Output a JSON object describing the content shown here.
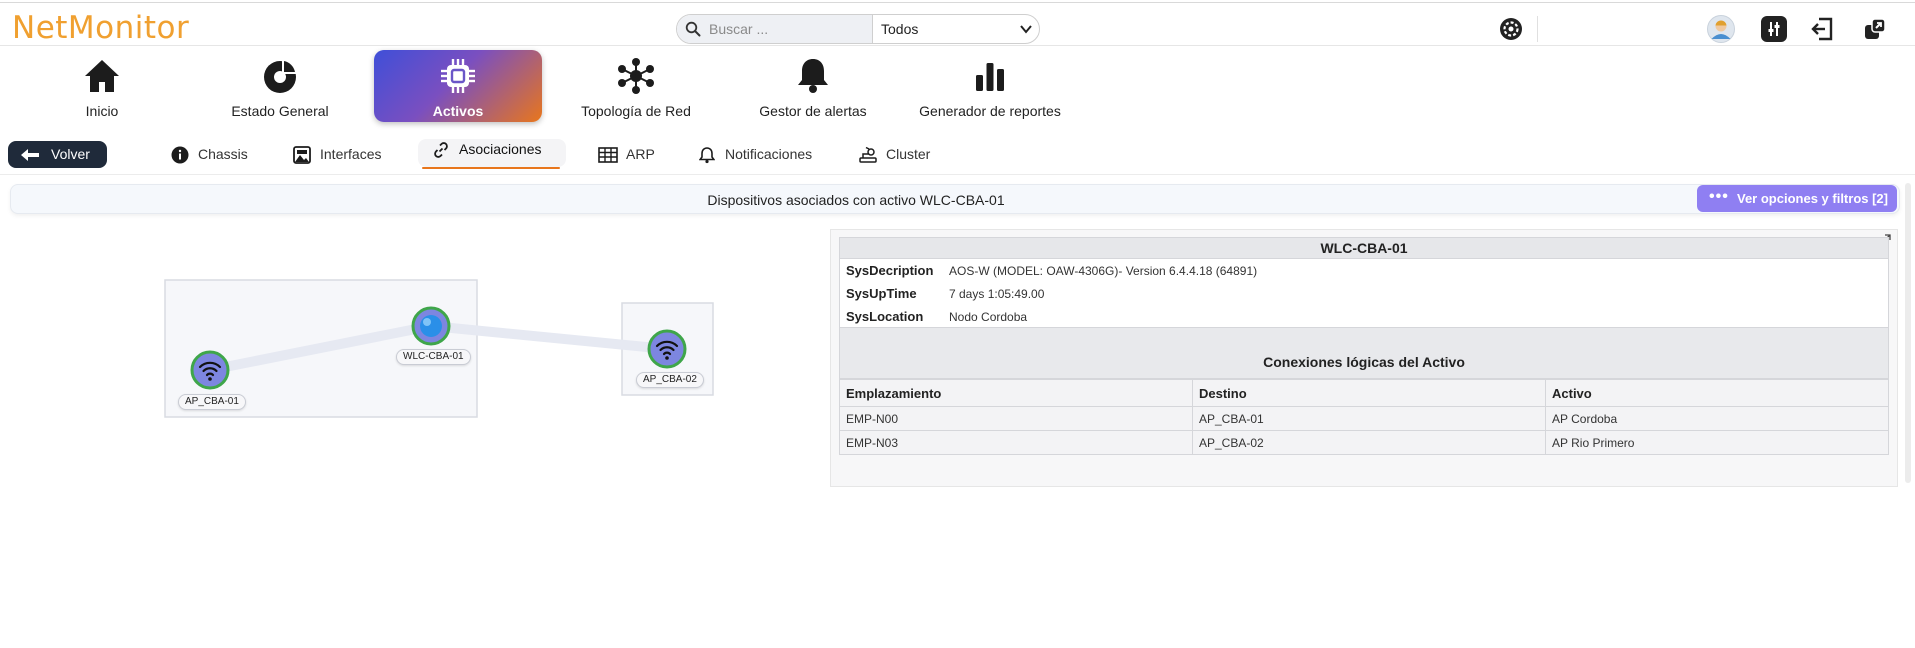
{
  "app": {
    "logo": "NetMonitor"
  },
  "search": {
    "placeholder": "Buscar ...",
    "scope": "Todos"
  },
  "topbar_icons": [
    "gear-icon",
    "user-avatar-icon",
    "sliders-icon",
    "logout-icon",
    "external-window-icon"
  ],
  "nav": [
    {
      "label": "Inicio",
      "icon": "home-icon"
    },
    {
      "label": "Estado General",
      "icon": "donut-chart-icon"
    },
    {
      "label": "Activos",
      "icon": "chip-icon",
      "active": true
    },
    {
      "label": "Topología de Red",
      "icon": "network-icon"
    },
    {
      "label": "Gestor de alertas",
      "icon": "bell-icon"
    },
    {
      "label": "Generador de reportes",
      "icon": "bar-chart-icon"
    }
  ],
  "back_label": "Volver",
  "subtabs": [
    {
      "label": "Chassis",
      "icon": "info-icon"
    },
    {
      "label": "Interfaces",
      "icon": "image-icon"
    },
    {
      "label": "Asociaciones",
      "icon": "link-icon",
      "active": true
    },
    {
      "label": "ARP",
      "icon": "table-icon"
    },
    {
      "label": "Notificaciones",
      "icon": "bell-outline-icon"
    },
    {
      "label": "Cluster",
      "icon": "cluster-icon"
    }
  ],
  "page_title": "Dispositivos asociados con activo WLC-CBA-01",
  "options_label": "Ver opciones y filtros [2]",
  "graph": {
    "nodes": [
      {
        "label": "AP_CBA-01",
        "icon": "wifi-icon"
      },
      {
        "label": "WLC-CBA-01",
        "icon": "controller-node-icon"
      },
      {
        "label": "AP_CBA-02",
        "icon": "wifi-icon"
      }
    ]
  },
  "panel": {
    "title": "WLC-CBA-01",
    "fields": [
      {
        "key": "SysDecription",
        "value": "AOS-W (MODEL: OAW-4306G)- Version 6.4.4.18 (64891)"
      },
      {
        "key": "SysUpTime",
        "value": "7 days 1:05:49.00"
      },
      {
        "key": "SysLocation",
        "value": "Nodo Cordoba"
      }
    ],
    "connections_title": "Conexiones lógicas del Activo",
    "columns": [
      "Emplazamiento",
      "Destino",
      "Activo"
    ],
    "rows": [
      [
        "EMP-N00",
        "AP_CBA-01",
        "AP Cordoba"
      ],
      [
        "EMP-N03",
        "AP_CBA-02",
        "AP Rio Primero"
      ]
    ]
  },
  "colors": {
    "accent_orange": "#e8761c",
    "accent_blue": "#3f4fd8",
    "options_purple": "#8f7ff2",
    "logo": "#f0a030"
  }
}
